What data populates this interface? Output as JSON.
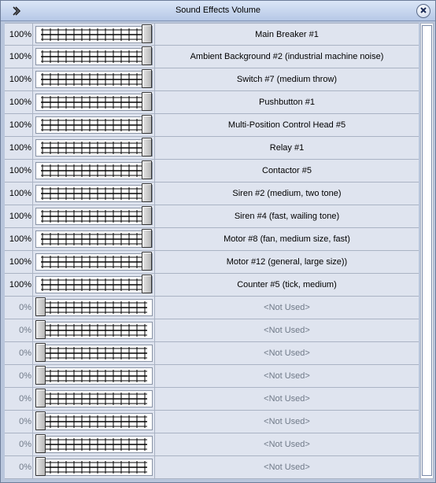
{
  "window": {
    "title": "Sound Effects Volume",
    "icon": "chevron-expand-icon",
    "close_icon": "close-icon"
  },
  "channels": [
    {
      "percent": "100%",
      "value": 100,
      "label": "Main Breaker #1"
    },
    {
      "percent": "100%",
      "value": 100,
      "label": "Ambient Background #2 (industrial machine noise)"
    },
    {
      "percent": "100%",
      "value": 100,
      "label": "Switch #7 (medium throw)"
    },
    {
      "percent": "100%",
      "value": 100,
      "label": "Pushbutton #1"
    },
    {
      "percent": "100%",
      "value": 100,
      "label": "Multi-Position Control Head #5"
    },
    {
      "percent": "100%",
      "value": 100,
      "label": "Relay #1"
    },
    {
      "percent": "100%",
      "value": 100,
      "label": "Contactor #5"
    },
    {
      "percent": "100%",
      "value": 100,
      "label": "Siren #2 (medium, two tone)"
    },
    {
      "percent": "100%",
      "value": 100,
      "label": "Siren #4 (fast, wailing tone)"
    },
    {
      "percent": "100%",
      "value": 100,
      "label": "Motor #8 (fan, medium size, fast)"
    },
    {
      "percent": "100%",
      "value": 100,
      "label": "Motor #12 (general, large size))"
    },
    {
      "percent": "100%",
      "value": 100,
      "label": "Counter #5 (tick, medium)"
    },
    {
      "percent": "0%",
      "value": 0,
      "label": "<Not Used>"
    },
    {
      "percent": "0%",
      "value": 0,
      "label": "<Not Used>"
    },
    {
      "percent": "0%",
      "value": 0,
      "label": "<Not Used>"
    },
    {
      "percent": "0%",
      "value": 0,
      "label": "<Not Used>"
    },
    {
      "percent": "0%",
      "value": 0,
      "label": "<Not Used>"
    },
    {
      "percent": "0%",
      "value": 0,
      "label": "<Not Used>"
    },
    {
      "percent": "0%",
      "value": 0,
      "label": "<Not Used>"
    },
    {
      "percent": "0%",
      "value": 0,
      "label": "<Not Used>"
    }
  ],
  "colors": {
    "row_bg": "#dfe4ef",
    "window_bg": "#b9c6dc",
    "unused_text": "#707a88"
  }
}
